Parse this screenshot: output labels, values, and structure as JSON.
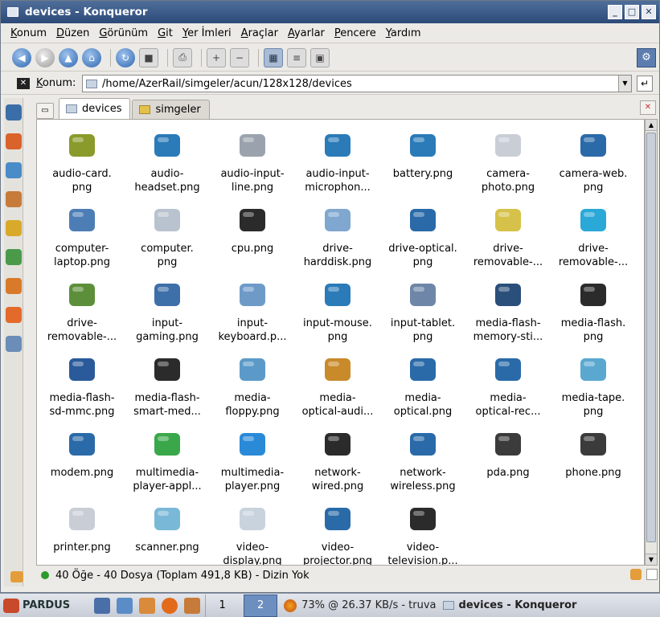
{
  "window": {
    "title": "devices - Konqueror"
  },
  "menu": [
    "Konum",
    "Düzen",
    "Görünüm",
    "Git",
    "Yer İmleri",
    "Araçlar",
    "Ayarlar",
    "Pencere",
    "Yardım"
  ],
  "location": {
    "label": "Konum:",
    "value": "/home/AzerRail/simgeler/acun/128x128/devices"
  },
  "tabs": [
    {
      "label": "devices",
      "active": true
    },
    {
      "label": "simgeler",
      "active": false
    }
  ],
  "files": [
    "audio-card.\npng",
    "audio-\nheadset.png",
    "audio-input-\nline.png",
    "audio-input-\nmicrophon...",
    "battery.png",
    "camera-\nphoto.png",
    "camera-web.\npng",
    "computer-\nlaptop.png",
    "computer.\npng",
    "cpu.png",
    "drive-\nharddisk.png",
    "drive-optical.\npng",
    "drive-\nremovable-...",
    "drive-\nremovable-...",
    "drive-\nremovable-...",
    "input-\ngaming.png",
    "input-\nkeyboard.p...",
    "input-mouse.\npng",
    "input-tablet.\npng",
    "media-flash-\nmemory-sti...",
    "media-flash.\npng",
    "media-flash-\nsd-mmc.png",
    "media-flash-\nsmart-med...",
    "media-\nfloppy.png",
    "media-\noptical-audi...",
    "media-\noptical.png",
    "media-\noptical-rec...",
    "media-tape.\npng",
    "modem.png",
    "multimedia-\nplayer-appl...",
    "multimedia-\nplayer.png",
    "network-\nwired.png",
    "network-\nwireless.png",
    "pda.png",
    "phone.png",
    "printer.png",
    "scanner.png",
    "video-\ndisplay.png",
    "video-\nprojector.png",
    "video-\ntelevision.p..."
  ],
  "icons": [
    {
      "name": "audio-card-icon",
      "color": "#8a9b2c"
    },
    {
      "name": "headset-icon",
      "color": "#2a7bb8"
    },
    {
      "name": "audio-line-icon",
      "color": "#9aa3ad"
    },
    {
      "name": "microphone-icon",
      "color": "#2a7bb8"
    },
    {
      "name": "battery-icon",
      "color": "#2a7bb8"
    },
    {
      "name": "camera-photo-icon",
      "color": "#c9ced6"
    },
    {
      "name": "webcam-icon",
      "color": "#2a6aa8"
    },
    {
      "name": "laptop-icon",
      "color": "#4d7db5"
    },
    {
      "name": "computer-icon",
      "color": "#b9c3cf"
    },
    {
      "name": "cpu-icon",
      "color": "#2b2b2b"
    },
    {
      "name": "harddisk-icon",
      "color": "#7fa7cf"
    },
    {
      "name": "optical-drive-icon",
      "color": "#2a6aa8"
    },
    {
      "name": "removable-drive-icon",
      "color": "#d6c24a"
    },
    {
      "name": "usb-stick-icon",
      "color": "#2aa8d8"
    },
    {
      "name": "usb-drive-icon",
      "color": "#5d8f3a"
    },
    {
      "name": "gamepad-icon",
      "color": "#3d6fa8"
    },
    {
      "name": "keyboard-icon",
      "color": "#6e9ac8"
    },
    {
      "name": "mouse-icon",
      "color": "#2a7bb8"
    },
    {
      "name": "tablet-icon",
      "color": "#6e86a8"
    },
    {
      "name": "memory-stick-icon",
      "color": "#2a4f7a"
    },
    {
      "name": "flash-card-icon",
      "color": "#2b2b2b"
    },
    {
      "name": "sd-card-icon",
      "color": "#2a5a9a"
    },
    {
      "name": "smart-media-icon",
      "color": "#2b2b2b"
    },
    {
      "name": "floppy-icon",
      "color": "#5b9ac8"
    },
    {
      "name": "audio-cd-icon",
      "color": "#c98a2a"
    },
    {
      "name": "cd-icon",
      "color": "#2a6aa8"
    },
    {
      "name": "cd-recordable-icon",
      "color": "#2a6aa8"
    },
    {
      "name": "tape-icon",
      "color": "#5aa8d0"
    },
    {
      "name": "modem-icon",
      "color": "#2a6aa8"
    },
    {
      "name": "media-player-icon",
      "color": "#3aa84a"
    },
    {
      "name": "media-player-blue-icon",
      "color": "#2a8ad8"
    },
    {
      "name": "network-wired-icon",
      "color": "#2b2b2b"
    },
    {
      "name": "network-wireless-icon",
      "color": "#2a6aa8"
    },
    {
      "name": "pda-icon",
      "color": "#3b3b3b"
    },
    {
      "name": "phone-icon",
      "color": "#3b3b3b"
    },
    {
      "name": "printer-icon",
      "color": "#c9ced6"
    },
    {
      "name": "scanner-icon",
      "color": "#7ab8d8"
    },
    {
      "name": "monitor-icon",
      "color": "#c9d3de"
    },
    {
      "name": "projector-icon",
      "color": "#2a6aa8"
    },
    {
      "name": "television-icon",
      "color": "#2b2b2b"
    }
  ],
  "status": {
    "text": "40 Öğe - 40 Dosya (Toplam 491,8 KB) - Dizin Yok"
  },
  "taskbar": {
    "logo": "PARDUS",
    "pager": [
      "1",
      "2"
    ],
    "task_firefox": "73% @ 26.37 KB/s - truva",
    "task_konqueror": "devices - Konqueror"
  }
}
